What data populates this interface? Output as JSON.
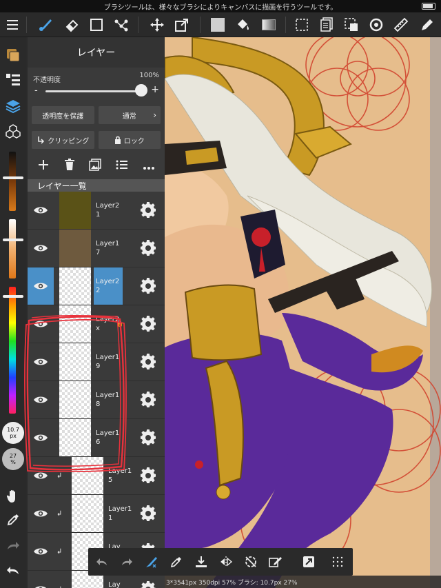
{
  "status_bar": {
    "message": "ブラシツールは、様々なブラシによりキャンバスに描画を行うツールです。"
  },
  "colors": {
    "accent": "#4a90c8",
    "panel_bg": "#3a3a3a",
    "toolbar_bg": "#2a2a2a",
    "annotation": "#e8323c",
    "canvas_bg": "#e6bd8c",
    "purple": "#5a2a9a",
    "gold": "#c89a22"
  },
  "toolbar": {
    "icons": [
      "menu-icon",
      "brush-icon",
      "eraser-icon",
      "select-rect-icon",
      "vector-icon",
      "move-icon",
      "transform-icon",
      "fill-color-icon",
      "bucket-icon",
      "gradient-icon",
      "selection-icon",
      "layer-panel-icon",
      "deselect-icon",
      "lasso-icon",
      "ruler-icon",
      "pen-icon"
    ]
  },
  "leftbar": {
    "brush_size": {
      "value": "10.7",
      "unit": "px"
    },
    "brush_opacity": {
      "value": "27",
      "unit": "%"
    }
  },
  "panel": {
    "title": "レイヤー",
    "opacity_label": "不透明度",
    "opacity_value": "100%",
    "opacity_fraction": 1.0,
    "protect_alpha": "透明度を保護",
    "blend_mode": "通常",
    "clipping": "クリッピング",
    "lock": "ロック",
    "list_header": "レイヤー一覧",
    "layers": [
      {
        "name": "Layer21",
        "thumb": "#5a5217",
        "selected": false,
        "clipped": false,
        "locked": false
      },
      {
        "name": "Layer17",
        "thumb": "#6e5a3e",
        "selected": false,
        "clipped": false,
        "locked": false
      },
      {
        "name": "Layer22",
        "thumb": "checker",
        "selected": true,
        "clipped": false,
        "locked": false
      },
      {
        "name": "Layer2x",
        "thumb": "checker",
        "selected": false,
        "clipped": false,
        "locked": true
      },
      {
        "name": "Layer19",
        "thumb": "checker",
        "selected": false,
        "clipped": false,
        "locked": false
      },
      {
        "name": "Layer18",
        "thumb": "checker",
        "selected": false,
        "clipped": false,
        "locked": false
      },
      {
        "name": "Layer16",
        "thumb": "checker",
        "selected": false,
        "clipped": false,
        "locked": false
      },
      {
        "name": "Layer15",
        "thumb": "checker",
        "selected": false,
        "clipped": true,
        "locked": false
      },
      {
        "name": "Layer11",
        "thumb": "checker",
        "selected": false,
        "clipped": true,
        "locked": false
      },
      {
        "name": "Lay",
        "thumb": "checker",
        "selected": false,
        "clipped": true,
        "locked": false
      },
      {
        "name": "Lay",
        "thumb": "checker",
        "selected": false,
        "clipped": true,
        "locked": false
      }
    ]
  },
  "bottombar": {
    "icons": [
      "undo-icon",
      "redo-icon",
      "brush-stabilizer-icon",
      "eyedropper-icon",
      "save-icon",
      "flip-icon",
      "rotate-reset-icon",
      "edit-icon",
      "snap-icon",
      "grid-icon"
    ]
  },
  "info": "3*3541px 350dpi 57% ブラシ: 10.7px 27%"
}
